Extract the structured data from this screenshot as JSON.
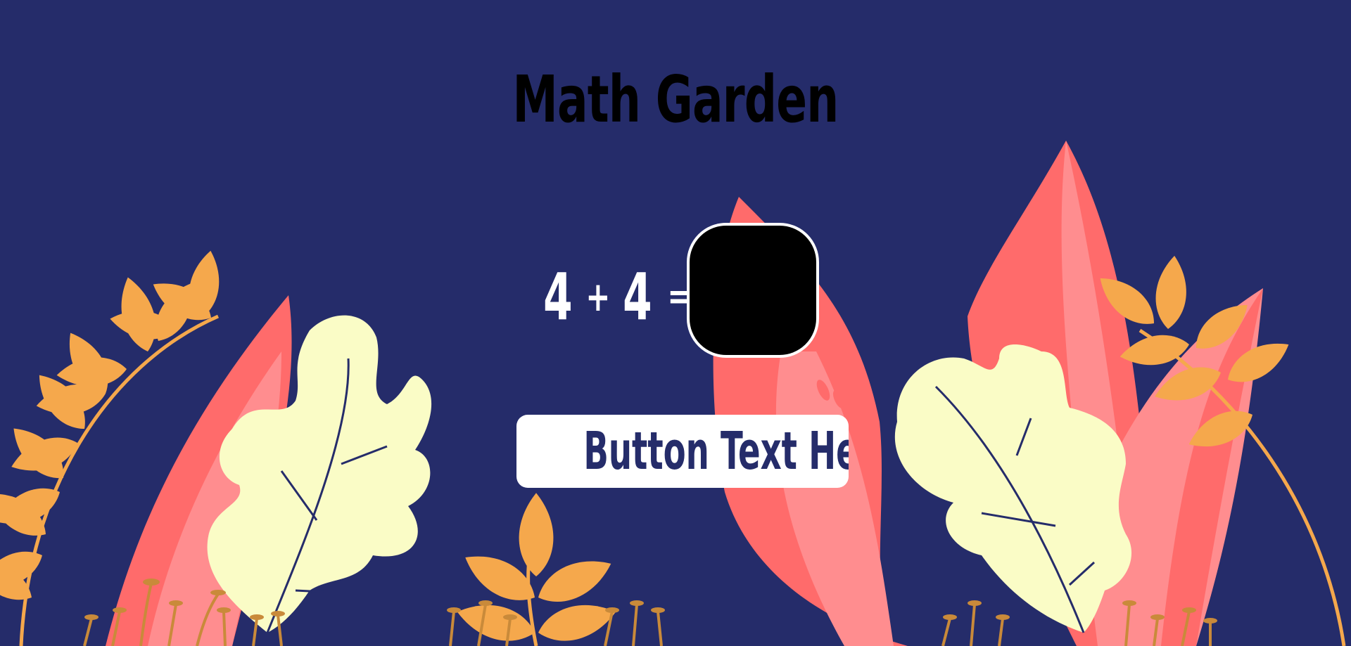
{
  "app": {
    "title": "Math Garden"
  },
  "equation": {
    "operand_a": "4",
    "operator": "+",
    "operand_b": "4",
    "equals": "="
  },
  "answer_canvas": {
    "value": ""
  },
  "action_button": {
    "label": "Button Text Here"
  },
  "colors": {
    "background": "#252c6a",
    "leaf_orange": "#f5a84c",
    "leaf_coral": "#ff6b6b",
    "leaf_pink": "#ff8d8f",
    "leaf_cream": "#fafcc6",
    "stem": "#c98a3a",
    "white": "#ffffff",
    "black": "#000000"
  },
  "icons": [
    "orange-fern-leaf-icon",
    "coral-leaf-icon",
    "oak-leaf-icon",
    "mushroom-stem-icon"
  ]
}
